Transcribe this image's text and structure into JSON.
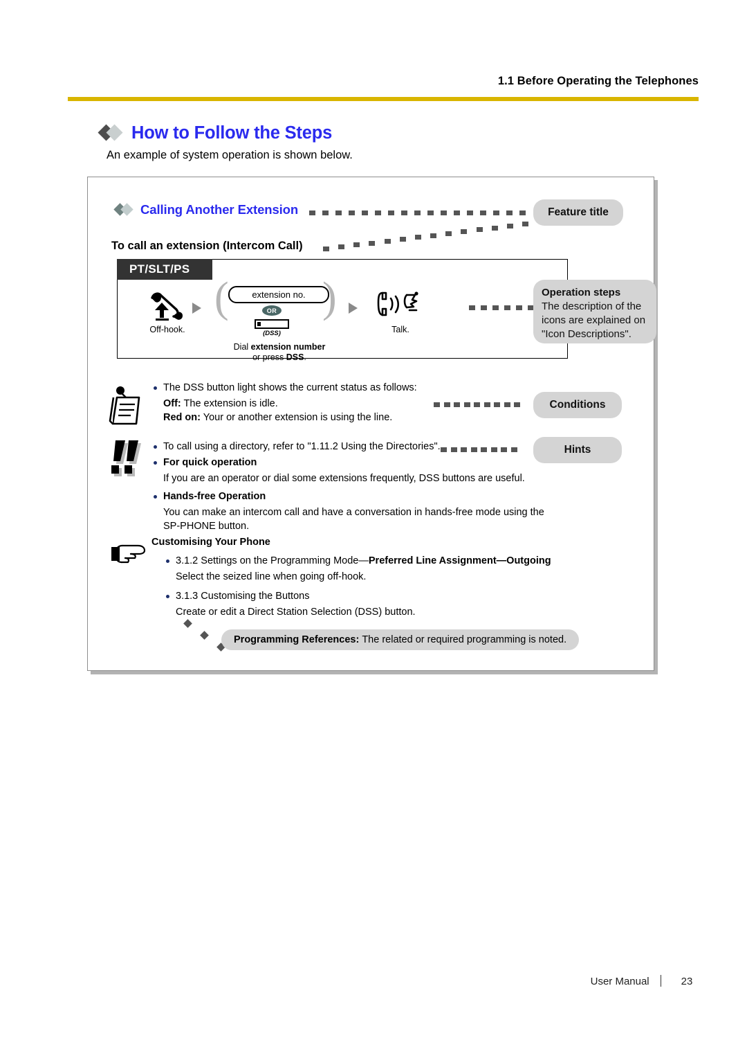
{
  "header": {
    "section": "1.1 Before Operating the Telephones",
    "rule_color": "#d9b500"
  },
  "page_heading": {
    "title": "How to Follow the Steps",
    "title_color": "#2a2aee",
    "intro": "An example of system operation is shown below."
  },
  "example": {
    "feature_title": "Calling Another Extension",
    "subhead": "To call an extension (Intercom Call)",
    "phone_types_tag": "PT/SLT/PS",
    "steps": [
      {
        "icon": "off-hook-handset-icon",
        "caption": "Off-hook."
      },
      {
        "icon": "dial-extension-icon",
        "bubble": "extension no.",
        "or_label": "OR",
        "button_label": "(DSS)",
        "caption_line1_plain": "Dial ",
        "caption_line1_bold": "extension number",
        "caption_line2_plain": "or press ",
        "caption_line2_bold": "DSS",
        "caption_line2_tail": "."
      },
      {
        "icon": "talk-handset-icon",
        "caption": "Talk."
      }
    ],
    "conditions": {
      "icon": "notepad-icon",
      "lead": "The DSS button light shows the current status as follows:",
      "rows": [
        {
          "label": "Off:",
          "text": "The extension is idle."
        },
        {
          "label": "Red on:",
          "text": "Your or another extension is using the line."
        }
      ]
    },
    "hints": {
      "icon": "double-exclamation-icon",
      "first": "To call using a directory, refer to \"1.11.2 Using the Directories\".",
      "items": [
        {
          "heading": "For quick operation",
          "body": "If you are an operator or dial some extensions frequently, DSS buttons are useful."
        },
        {
          "heading": "Hands-free Operation",
          "body": "You can make an intercom call and have a conversation in hands-free mode using the SP-PHONE button."
        }
      ]
    },
    "customising": {
      "icon": "pointing-hand-icon",
      "heading": "Customising Your Phone",
      "items": [
        {
          "ref_plain": "3.1.2 Settings on the Programming Mode—",
          "ref_bold": "Preferred Line Assignment—Outgoing",
          "body": "Select the seized line when going off-hook."
        },
        {
          "ref_plain": "3.1.3 Customising the Buttons",
          "ref_bold": "",
          "body": "Create or edit a Direct Station Selection (DSS) button."
        }
      ]
    },
    "callouts": {
      "feature_title": "Feature title",
      "operation_steps_title": "Operation steps",
      "operation_steps_body": "The description of the icons are explained on \"Icon Descriptions\".",
      "conditions": "Conditions",
      "hints": "Hints",
      "programming_label": "Programming References:",
      "programming_text": "The related or required programming is noted."
    }
  },
  "footer": {
    "manual": "User Manual",
    "page": "23"
  }
}
